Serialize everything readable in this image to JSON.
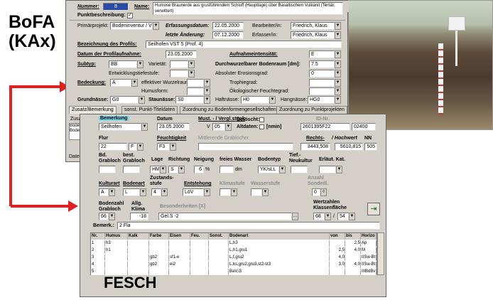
{
  "labels": {
    "bofa_line1": "BoFA",
    "bofa_line2": "(KAx)",
    "fesch": "FESCH"
  },
  "bofa": {
    "nummer_label": "Nummer:",
    "nummer_value": "8",
    "name_label": "Name:",
    "name_value": "Humose Braunerde aus grusführendem Schluff (Hauptlage) über Basaltischem Vulkanit (Tertiär, verwittert)",
    "punktbeschreibung_label": "Punktbeschreibung:",
    "primaerprojekt_label": "Primärprojekt:",
    "primaerprojekt_value": "Bodeninventur / VST",
    "erfassungsdatum_label": "Erfassungsdatum:",
    "erfassungsdatum_value": "22.05.2000",
    "bearbeiter_label": "Bearbeiter/in:",
    "bearbeiter_value": "Friedrich, Klaus",
    "letzte_aenderung_label": "letzte Änderung:",
    "letzte_aenderung_value": "07.12.2000",
    "erfasser_label": "Erfasser/in:",
    "erfasser_value": "Friedrich, Klaus",
    "bezeichnung_label": "Bezeichnung des Profils:",
    "bezeichnung_value": "Seilhofen VST 5 (Prof. 4)",
    "datum_label": "Datum der Profilaufnahme:",
    "datum_value": "23.05.2000",
    "aufnahme_label": "Aufnahmeintensität:",
    "aufnahme_value": "E",
    "subtyp_label": "Subtyp:",
    "subtyp_value": "BB",
    "varietaet_label": "Varietät:",
    "entwicklung_label": "Entwicklungstiefestufe:",
    "durchwurzel_label": "Durchwurzelbarer Bodenraum [dm]:",
    "durchwurzel_value": "7.5",
    "erosion_label": "Absoluter Erosionsgrad:",
    "erosion_value": "0",
    "bedeckung_label": "Bedeckung:",
    "bedeckung_value": "A",
    "wurzelraum_label": "effektiver Wurzelraum:",
    "humusform_label": "Humusform:",
    "trophie_label": "Trophiegrad:",
    "feuchte_label": "Ökologischer Feuchtegrad:",
    "grundnaesse_label": "Grundnässe:",
    "grundnaesse_value": "G0",
    "staunaesse_label": "Staunässe:",
    "staunaesse_value": "S0",
    "haftnaesse_label": "Haftnässe:",
    "haftnaesse_value": "H0",
    "hangnaesse_label": "Hangnässe:",
    "hangnaesse_value": "HG0",
    "tabs": [
      "Zusatz/Bemerkung",
      "sonst. Punkt-Titeldaten",
      "Zuordnung zu Bodenformengesellschaften",
      "Zuordnung zu Punktprojekten"
    ],
    "zusatz_label": "Zusatz:",
    "zusatz_text1": "Bodeninv",
    "zusatz_text2": "Bodenscl",
    "datens_label": "Datens"
  },
  "fesch": {
    "bemerkung_label": "Bemerkung",
    "bemerkung_value": "Seilhofen",
    "datum_label": "Datum",
    "datum_value": "23.05.2000",
    "must_label": "Must. - / Vergl.stück",
    "must_v": "V",
    "must_num": "05",
    "geloescht_label": "Gelöscht:",
    "altdaten_label": "Altdaten:",
    "nmin_label": "[nmin]",
    "idnr_label": "ID-Nr.",
    "idnr_value": "2601395F22",
    "idnr_suffix": "02400",
    "flur_label": "Flur",
    "flur_value": "22",
    "flur_f": "F",
    "feuchtigkeit_label": "Feuchtigkeit",
    "feuchtigkeit_value": "F3",
    "mitt_label": "Mittlerende Grablöcher",
    "rechts_label": "Rechts-",
    "hochwert_label": "/ Hochwert",
    "nn_label": "NN",
    "rechts_value": "3443,508",
    "hochwert_value": "5610,815",
    "nn_value": "505",
    "bd_label": "Bd. Grabloch",
    "best_label": "best. Grabloch",
    "lage_label": "Lage",
    "richtung_label": "Richtung",
    "neigung_label": "Neigung",
    "freies_label": "freies Wasser",
    "bodentyp_label": "Bodentyp",
    "tief_label": "Tief.- Neukultur",
    "erlaeut_label": "Erläut. Kat.",
    "lage_value": "HM",
    "richtung_value": "S",
    "neigung_value": "6",
    "neigung_unit": "%",
    "freies_unit": "dm",
    "bodentyp_value": "YK/sLL",
    "kulturart_label": "Kulturart",
    "bodenart_label": "Bodenart",
    "zustand_label": "Zustands- stufe",
    "entstehung_label": "Entstehung",
    "klimastufe_label": "Klimastufe",
    "wasserstufe_label": "Wasserstufe",
    "anzahl_label": "Anzahl Sondeill.",
    "kulturart_value": "A",
    "bodenart_value": "L",
    "zustand_value": "4",
    "entstehung_value": "LöV",
    "anzahl_value": "0",
    "bodenzahl_label": "Bodenzahl Grabloch",
    "allg_label": "Allg. Klima",
    "besonderheiten_label": "Besonderheiten [X]",
    "wertzahlen_label": "Wertzahlen Klassenfläche",
    "bodenzahl_value": "66",
    "allg_value": "-18",
    "besonderheiten_value": "Gel.S -2",
    "wert1": "68",
    "wert2": "54",
    "bemerk_label": "Bemerk.:",
    "bemerk_value": "2 Fla",
    "cols": [
      "Nr.",
      "Humus",
      "Kalk",
      "Farbe",
      "Eisen",
      "Feu.",
      "Sonst.",
      "Bodenart",
      "von",
      "bis",
      "Horizo"
    ],
    "rows": [
      {
        "nr": "1",
        "humus": "h3",
        "kalk": "",
        "farbe": "",
        "eisen": "",
        "feu": "",
        "sonst": "",
        "bodenart": "L,h3",
        "von": "",
        "bis": "2,5",
        "horizont": "Ap"
      },
      {
        "nr": "2",
        "humus": "h1",
        "kalk": "",
        "farbe": "",
        "eisen": "",
        "feu": "",
        "sonst": "",
        "bodenart": "L,h1,gru1",
        "von": "2,5",
        "bis": "4,0",
        "horizont": "M"
      },
      {
        "nr": "3",
        "humus": "",
        "kalk": "",
        "farbe": "gb2",
        "eisen": "sf1-e",
        "feu": "",
        "sonst": "",
        "bodenart": "L,f,gru2",
        "von": "4,0",
        "bis": "",
        "horizont": "IISw-Bt"
      },
      {
        "nr": "4",
        "humus": "",
        "kalk": "",
        "farbe": "gb2",
        "eisen": "ei2",
        "feu": "",
        "sonst": "",
        "bodenart": "L,ks,gru2,gru3,st2-st3",
        "von": "3,0",
        "bis": "4,0",
        "horizont": "IISw-Bt"
      },
      {
        "nr": "5",
        "humus": "",
        "kalk": "",
        "farbe": "",
        "eisen": "",
        "feu": "",
        "sonst": "",
        "bodenart": "BaV,l3",
        "von": "",
        "bis": "",
        "horizont": "IIIBdBv"
      }
    ]
  }
}
